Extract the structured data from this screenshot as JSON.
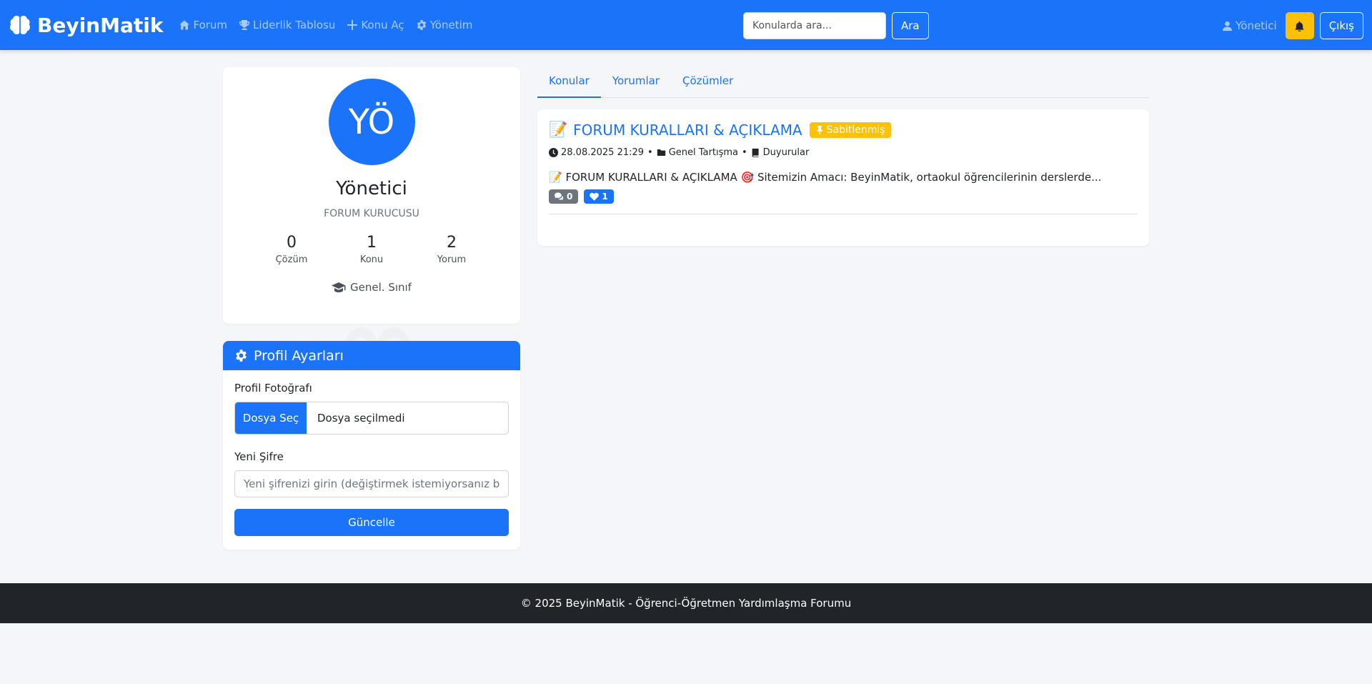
{
  "nav": {
    "brand": "BeyinMatik",
    "links": [
      {
        "label": "Forum",
        "icon": "home-icon"
      },
      {
        "label": "Liderlik Tablosu",
        "icon": "trophy-icon"
      },
      {
        "label": "Konu Aç",
        "icon": "plus-icon"
      },
      {
        "label": "Yönetim",
        "icon": "gear-icon"
      }
    ],
    "search_placeholder": "Konularda ara...",
    "search_button": "Ara",
    "user_label": "Yönetici",
    "logout": "Çıkış"
  },
  "profile": {
    "initials": "YÖ",
    "name": "Yönetici",
    "role": "FORUM KURUCUSU",
    "stats": [
      {
        "value": "0",
        "label": "Çözüm"
      },
      {
        "value": "1",
        "label": "Konu"
      },
      {
        "value": "2",
        "label": "Yorum"
      }
    ],
    "grade": "Genel. Sınıf"
  },
  "settings": {
    "title": "Profil Ayarları",
    "photo_label": "Profil Fotoğrafı",
    "file_button": "Dosya Seç",
    "file_status": "Dosya seçilmedi",
    "password_label": "Yeni Şifre",
    "password_placeholder": "Yeni şifrenizi girin (değiştirmek istemiyorsanız boş bırakın)",
    "submit": "Güncelle"
  },
  "tabs": [
    "Konular",
    "Yorumlar",
    "Çözümler"
  ],
  "topic": {
    "emoji": "📝",
    "title": "FORUM KURALLARI & AÇIKLAMA",
    "pinned_label": "Sabitlenmiş",
    "date": "28.08.2025 21:29",
    "category": "Genel Tartışma",
    "subcategory": "Duyurular",
    "excerpt": "📝 FORUM KURALLARI & AÇIKLAMA 🎯 Sitemizin Amacı: BeyinMatik, ortaokul öğrencilerinin derslerde...",
    "comments": "0",
    "likes": "1"
  },
  "footer": "© 2025 BeyinMatik - Öğrenci-Öğretmen Yardımlaşma Forumu",
  "colors": {
    "primary": "#1a73f8",
    "warning": "#ffc107",
    "dark": "#212529"
  }
}
